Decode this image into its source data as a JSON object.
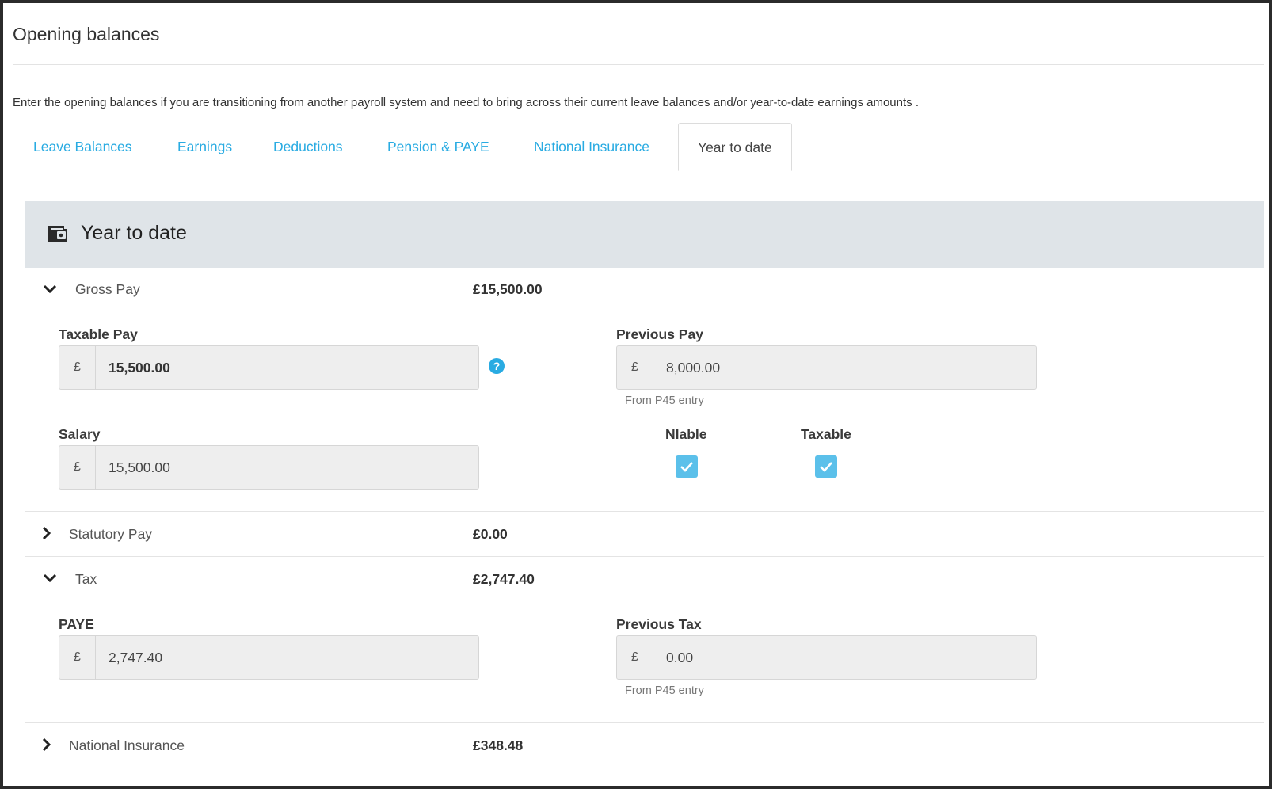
{
  "page": {
    "title": "Opening balances",
    "intro": "Enter the opening balances if you are transitioning from another payroll system and need to bring across their current leave balances and/or year-to-date earnings amounts ."
  },
  "tabs": [
    {
      "label": "Leave Balances",
      "active": false
    },
    {
      "label": "Earnings",
      "active": false
    },
    {
      "label": "Deductions",
      "active": false
    },
    {
      "label": "Pension & PAYE",
      "active": false
    },
    {
      "label": "National Insurance",
      "active": false
    },
    {
      "label": "Year to date",
      "active": true
    }
  ],
  "panel": {
    "title": "Year to date",
    "icon": "wallet-icon"
  },
  "gross_pay": {
    "label": "Gross Pay",
    "amount": "£15,500.00",
    "expanded": true,
    "taxable_pay": {
      "label": "Taxable Pay",
      "currency": "£",
      "value": "15,500.00"
    },
    "previous_pay": {
      "label": "Previous Pay",
      "currency": "£",
      "value": "8,000.00",
      "helper": "From P45 entry"
    },
    "salary": {
      "label": "Salary",
      "currency": "£",
      "value": "15,500.00"
    },
    "niable": {
      "label": "NIable",
      "checked": true
    },
    "taxable": {
      "label": "Taxable",
      "checked": true
    }
  },
  "statutory_pay": {
    "label": "Statutory Pay",
    "amount": "£0.00",
    "expanded": false
  },
  "tax": {
    "label": "Tax",
    "amount": "£2,747.40",
    "expanded": true,
    "paye": {
      "label": "PAYE",
      "currency": "£",
      "value": "2,747.40"
    },
    "previous_tax": {
      "label": "Previous Tax",
      "currency": "£",
      "value": "0.00",
      "helper": "From P45 entry"
    }
  },
  "national_insurance": {
    "label": "National Insurance",
    "amount": "£348.48",
    "expanded": false
  },
  "colors": {
    "accent": "#29abe2",
    "checkbox": "#5bc0ea",
    "panel_header": "#dfe4e8",
    "input_bg": "#eeeeee"
  }
}
